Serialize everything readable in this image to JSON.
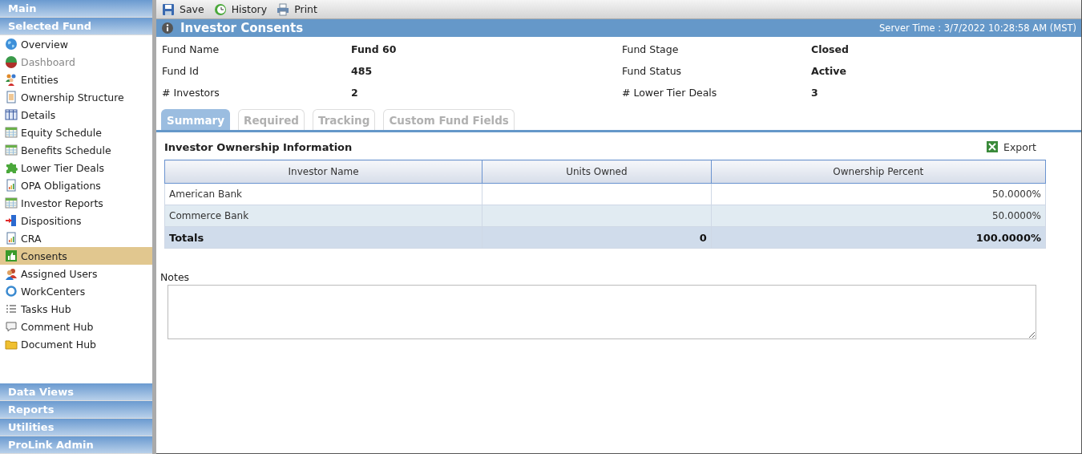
{
  "sidebar": {
    "top_headers": [
      "Main",
      "Selected Fund"
    ],
    "items": [
      {
        "label": "Overview",
        "kind": "globe",
        "disabled": false,
        "selected": false
      },
      {
        "label": "Dashboard",
        "kind": "pie",
        "disabled": true,
        "selected": false
      },
      {
        "label": "Entities",
        "kind": "people",
        "disabled": false,
        "selected": false
      },
      {
        "label": "Ownership Structure",
        "kind": "document",
        "disabled": false,
        "selected": false
      },
      {
        "label": "Details",
        "kind": "columns",
        "disabled": false,
        "selected": false
      },
      {
        "label": "Equity Schedule",
        "kind": "grid",
        "disabled": false,
        "selected": false
      },
      {
        "label": "Benefits Schedule",
        "kind": "grid",
        "disabled": false,
        "selected": false
      },
      {
        "label": "Lower Tier Deals",
        "kind": "puzzle",
        "disabled": false,
        "selected": false
      },
      {
        "label": "OPA Obligations",
        "kind": "report",
        "disabled": false,
        "selected": false
      },
      {
        "label": "Investor Reports",
        "kind": "grid",
        "disabled": false,
        "selected": false
      },
      {
        "label": "Dispositions",
        "kind": "door",
        "disabled": false,
        "selected": false
      },
      {
        "label": "CRA",
        "kind": "report",
        "disabled": false,
        "selected": false
      },
      {
        "label": "Consents",
        "kind": "thumb",
        "disabled": false,
        "selected": true
      },
      {
        "label": "Assigned Users",
        "kind": "users",
        "disabled": false,
        "selected": false
      },
      {
        "label": "WorkCenters",
        "kind": "ring",
        "disabled": false,
        "selected": false
      },
      {
        "label": "Tasks Hub",
        "kind": "list",
        "disabled": false,
        "selected": false
      },
      {
        "label": "Comment Hub",
        "kind": "comment",
        "disabled": false,
        "selected": false
      },
      {
        "label": "Document Hub",
        "kind": "folder",
        "disabled": false,
        "selected": false
      }
    ],
    "bottom_headers": [
      "Data Views",
      "Reports",
      "Utilities",
      "ProLink Admin"
    ]
  },
  "toolbar": [
    {
      "label": "Save",
      "kind": "save"
    },
    {
      "label": "History",
      "kind": "clock"
    },
    {
      "label": "Print",
      "kind": "printer"
    }
  ],
  "title_bar": {
    "title": "Investor Consents",
    "server_time": "Server Time : 3/7/2022 10:28:58 AM (MST)"
  },
  "fund_info": [
    {
      "label": "Fund Name",
      "value": "Fund 60"
    },
    {
      "label": "Fund Stage",
      "value": "Closed"
    },
    {
      "label": "Fund Id",
      "value": "485"
    },
    {
      "label": "Fund Status",
      "value": "Active"
    },
    {
      "label": "# Investors",
      "value": "2"
    },
    {
      "label": "# Lower Tier Deals",
      "value": "3"
    }
  ],
  "tabs": [
    {
      "label": "Summary",
      "selected": true
    },
    {
      "label": "Required",
      "selected": false
    },
    {
      "label": "Tracking",
      "selected": false
    },
    {
      "label": "Custom Fund Fields",
      "selected": false
    }
  ],
  "section_title": "Investor Ownership Information",
  "export_button": "Export",
  "table": {
    "columns": [
      "Investor Name",
      "Units Owned",
      "Ownership Percent"
    ],
    "rows": [
      [
        "American Bank",
        "",
        "50.0000%"
      ],
      [
        "Commerce Bank",
        "",
        "50.0000%"
      ]
    ],
    "totals": [
      "Totals",
      "0",
      "100.0000%"
    ]
  },
  "notes": {
    "label": "Notes"
  }
}
